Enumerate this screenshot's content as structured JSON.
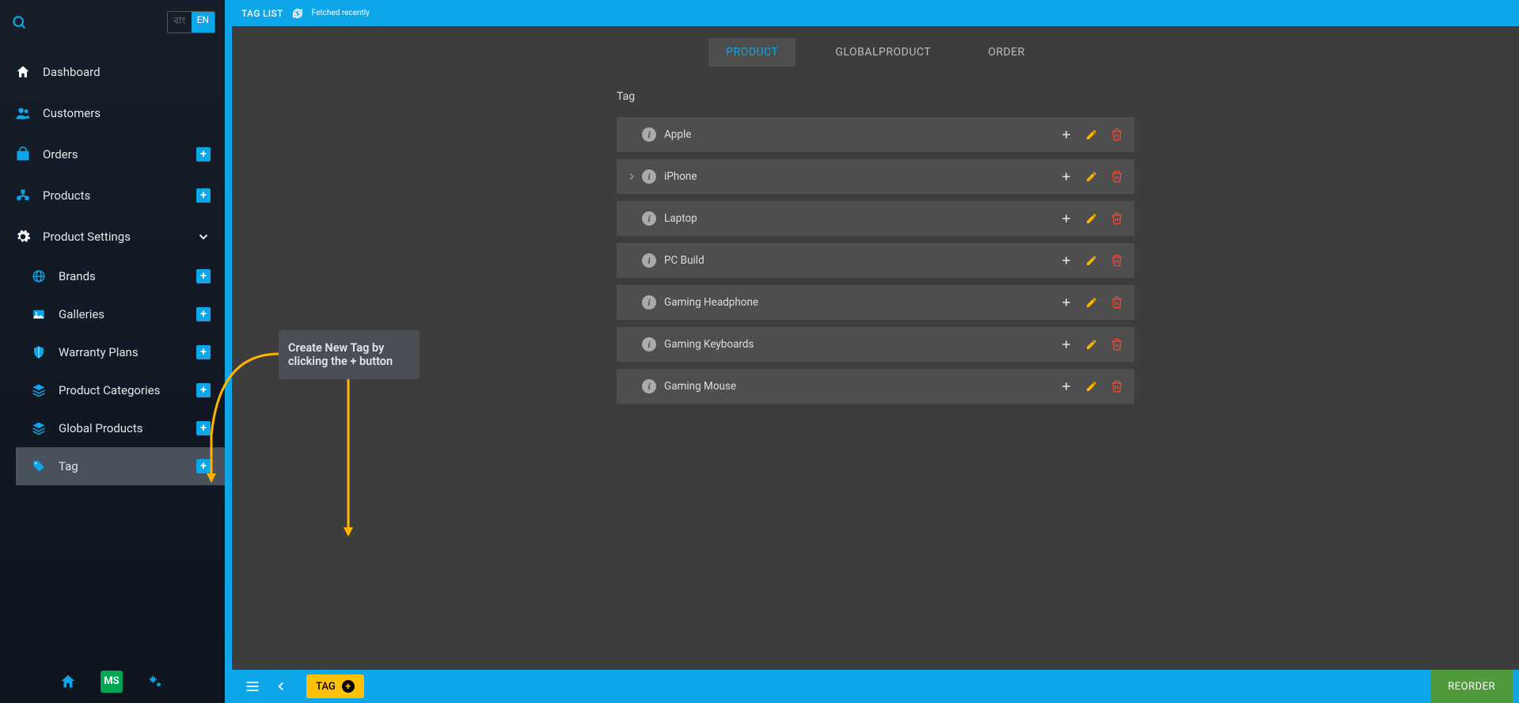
{
  "sidebar": {
    "langBn": "বাং",
    "langEn": "EN",
    "items": [
      {
        "label": "Dashboard"
      },
      {
        "label": "Customers"
      },
      {
        "label": "Orders"
      },
      {
        "label": "Products"
      },
      {
        "label": "Product Settings"
      }
    ],
    "subitems": [
      {
        "label": "Brands"
      },
      {
        "label": "Galleries"
      },
      {
        "label": "Warranty Plans"
      },
      {
        "label": "Product Categories"
      },
      {
        "label": "Global Products"
      },
      {
        "label": "Tag"
      }
    ],
    "bottom": {
      "msLabel": "MS"
    }
  },
  "topbar": {
    "title": "TAG LIST",
    "status": "Fetched recently"
  },
  "tabs": [
    {
      "label": "PRODUCT"
    },
    {
      "label": "GLOBALPRODUCT"
    },
    {
      "label": "ORDER"
    }
  ],
  "tagSection": {
    "header": "Tag"
  },
  "tags": [
    {
      "name": "Apple",
      "hasChevron": false
    },
    {
      "name": "iPhone",
      "hasChevron": true
    },
    {
      "name": "Laptop",
      "hasChevron": false
    },
    {
      "name": "PC Build",
      "hasChevron": false
    },
    {
      "name": "Gaming Headphone",
      "hasChevron": false
    },
    {
      "name": "Gaming Keyboards",
      "hasChevron": false
    },
    {
      "name": "Gaming Mouse",
      "hasChevron": false
    }
  ],
  "bottombar": {
    "tagBtn": "TAG",
    "reorder": "REORDER"
  },
  "tooltip": {
    "text": "Create New Tag by clicking the + button"
  }
}
